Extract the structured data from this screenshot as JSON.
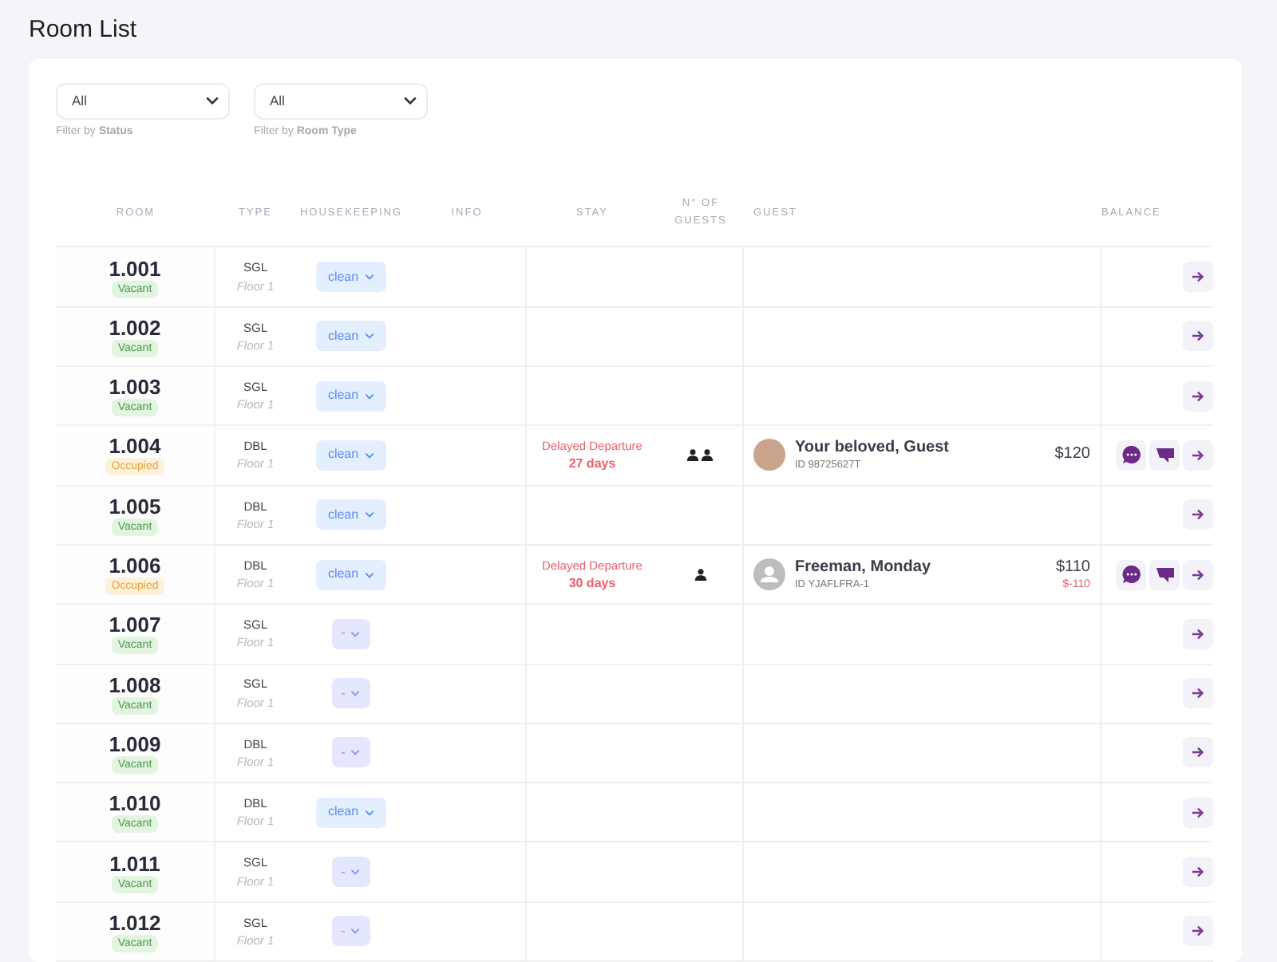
{
  "title": "Room List",
  "filters": [
    {
      "value": "All",
      "caption": "Filter by **Status**"
    },
    {
      "value": "All",
      "caption": "Filter by **Room Type**"
    }
  ],
  "columns": [
    "ROOM",
    "TYPE",
    "HOUSEKEEPING",
    "INFO",
    "STAY",
    "N° OF GUESTS",
    "GUEST",
    "BALANCE"
  ],
  "rows": [
    {
      "room": "1.001",
      "status": {
        "kind": "vacant",
        "label": "Vacant"
      },
      "type": "SGL",
      "floor": "Floor 1",
      "housekeeping": {
        "kind": "clean",
        "label": "clean"
      }
    },
    {
      "room": "1.002",
      "status": {
        "kind": "vacant",
        "label": "Vacant"
      },
      "type": "SGL",
      "floor": "Floor 1",
      "housekeeping": {
        "kind": "clean",
        "label": "clean"
      }
    },
    {
      "room": "1.003",
      "status": {
        "kind": "vacant",
        "label": "Vacant"
      },
      "type": "SGL",
      "floor": "Floor 1",
      "housekeeping": {
        "kind": "clean",
        "label": "clean"
      }
    },
    {
      "room": "1.004",
      "status": {
        "kind": "occupied",
        "label": "Occupied"
      },
      "type": "DBL",
      "floor": "Floor 1",
      "housekeeping": {
        "kind": "clean",
        "label": "clean"
      },
      "stay": {
        "note": "Delayed Departure",
        "days": "27 days"
      },
      "occupants": [
        {
          "kind": "adult"
        },
        {
          "kind": "adult"
        }
      ],
      "guest": {
        "photo": true,
        "name": "Your beloved, Guest",
        "id": "ID 98725627T"
      },
      "balance": "$120",
      "actions": [
        {
          "kind": "chat"
        },
        {
          "kind": "flag"
        }
      ]
    },
    {
      "room": "1.005",
      "status": {
        "kind": "vacant",
        "label": "Vacant"
      },
      "type": "DBL",
      "floor": "Floor 1",
      "housekeeping": {
        "kind": "clean",
        "label": "clean"
      }
    },
    {
      "room": "1.006",
      "status": {
        "kind": "occupied",
        "label": "Occupied"
      },
      "type": "DBL",
      "floor": "Floor 1",
      "housekeeping": {
        "kind": "clean",
        "label": "clean"
      },
      "stay": {
        "note": "Delayed Departure",
        "days": "30 days"
      },
      "occupants": [
        {
          "kind": "adult"
        }
      ],
      "guest": {
        "photo": false,
        "name": "Freeman, Monday",
        "id": "ID YJAFLFRA-1"
      },
      "balance": "$110",
      "due": "$-110",
      "actions": [
        {
          "kind": "chat"
        },
        {
          "kind": "flag"
        }
      ]
    },
    {
      "room": "1.007",
      "status": {
        "kind": "vacant",
        "label": "Vacant"
      },
      "type": "SGL",
      "floor": "Floor 1",
      "housekeeping": {
        "kind": "none",
        "label": "-"
      }
    },
    {
      "room": "1.008",
      "status": {
        "kind": "vacant",
        "label": "Vacant"
      },
      "type": "SGL",
      "floor": "Floor 1",
      "housekeeping": {
        "kind": "none",
        "label": "-"
      }
    },
    {
      "room": "1.009",
      "status": {
        "kind": "vacant",
        "label": "Vacant"
      },
      "type": "DBL",
      "floor": "Floor 1",
      "housekeeping": {
        "kind": "none",
        "label": "-"
      }
    },
    {
      "room": "1.010",
      "status": {
        "kind": "vacant",
        "label": "Vacant"
      },
      "type": "DBL",
      "floor": "Floor 1",
      "housekeeping": {
        "kind": "clean",
        "label": "clean"
      }
    },
    {
      "room": "1.011",
      "status": {
        "kind": "vacant",
        "label": "Vacant"
      },
      "type": "SGL",
      "floor": "Floor 1",
      "housekeeping": {
        "kind": "none",
        "label": "-"
      }
    },
    {
      "room": "1.012",
      "status": {
        "kind": "vacant",
        "label": "Vacant"
      },
      "type": "SGL",
      "floor": "Floor 1",
      "housekeeping": {
        "kind": "none",
        "label": "-"
      }
    }
  ]
}
